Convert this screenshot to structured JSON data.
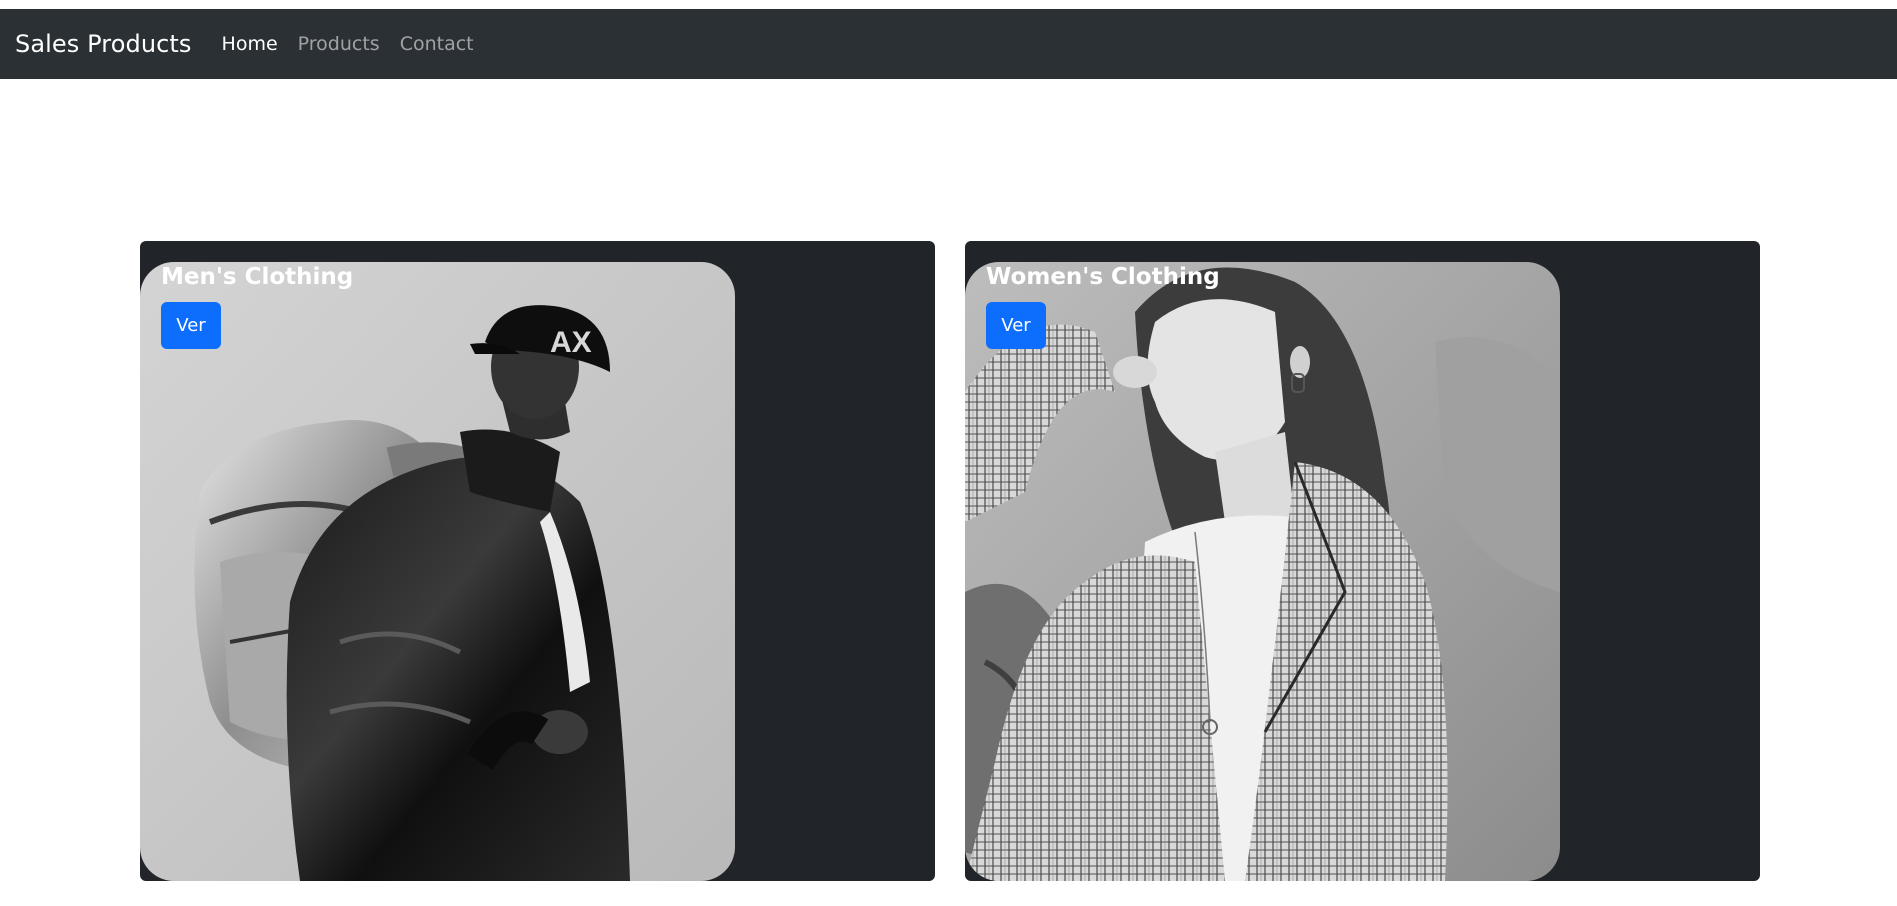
{
  "navbar": {
    "brand": "Sales Products",
    "links": [
      {
        "label": "Home",
        "active": true
      },
      {
        "label": "Products",
        "active": false
      },
      {
        "label": "Contact",
        "active": false
      }
    ]
  },
  "colors": {
    "navbar_bg": "#2b3035",
    "card_bg": "#212529",
    "button_bg": "#0d6efd"
  },
  "cards": [
    {
      "title": "Men's Clothing",
      "button_label": "Ver",
      "image": "man-with-backpack-photo"
    },
    {
      "title": "Women's Clothing",
      "button_label": "Ver",
      "image": "woman-in-plaid-blazer-photo"
    }
  ]
}
